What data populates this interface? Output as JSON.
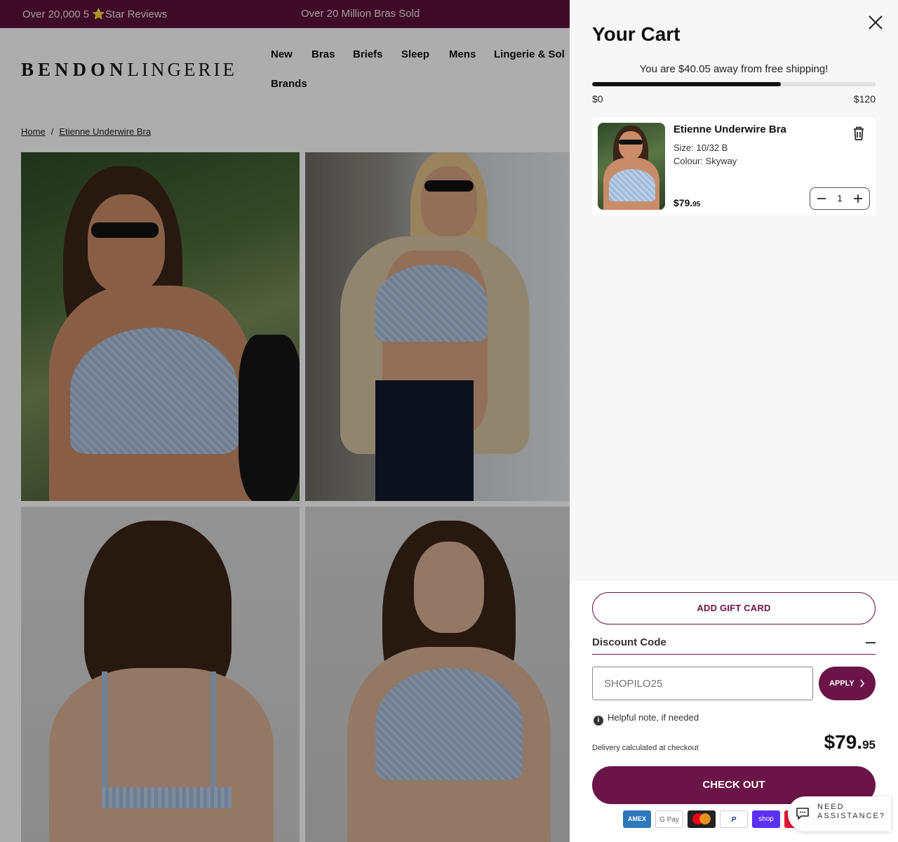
{
  "announcement": {
    "left": "Over 20,000 5 ",
    "star": "⭐",
    "left_tail": "Star Reviews",
    "center": "Over 20 Million Bras Sold"
  },
  "header": {
    "logo_bold": "BENDON",
    "logo_light": "LINGERIE",
    "nav": [
      "New",
      "Bras",
      "Briefs",
      "Sleep",
      "Mens",
      "Lingerie & Sol",
      "Brands"
    ]
  },
  "breadcrumb": {
    "home": "Home",
    "separator": "/",
    "current": "Etienne Underwire Bra"
  },
  "cart": {
    "title": "Your Cart",
    "shipping_message": "You are $40.05 away from free shipping!",
    "progress": {
      "value": 79.95,
      "max": 120,
      "min_label": "$0",
      "max_label": "$120"
    },
    "item": {
      "name": "Etienne Underwire Bra",
      "size": "Size: 10/32 B",
      "colour": "Colour: Skyway",
      "price_main": "$79.",
      "price_cents": "95",
      "quantity": "1"
    },
    "gift_card_label": "ADD GIFT CARD",
    "discount": {
      "label": "Discount Code",
      "input_placeholder": "SHOPILO25",
      "input_value": "",
      "apply_label": "APPLY"
    },
    "note": "Helpful note, if needed",
    "delivery": "Delivery calculated at checkout",
    "total_main": "$79.",
    "total_cents": "95",
    "checkout_label": "CHECK OUT",
    "payments": {
      "amex": "AMEX",
      "gpay": "G Pay",
      "paypal": "P",
      "shop": "shop",
      "unionpay": "U"
    }
  },
  "help": {
    "line1": "NEED",
    "line2": "ASSISTANCE?"
  },
  "colors": {
    "brand": "#6b1448",
    "announcement_bg": "#5d0f3a",
    "drawer_bg": "#f7f7f7"
  }
}
